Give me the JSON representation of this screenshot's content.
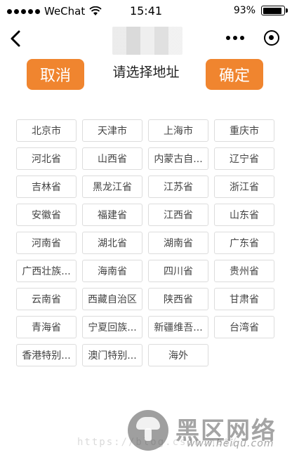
{
  "status_bar": {
    "carrier": "WeChat",
    "time": "15:41",
    "battery": "93%"
  },
  "navbar": {
    "back_icon": "chevron-left-icon",
    "more_icon": "more-dots-icon",
    "close_icon": "target-circle-icon"
  },
  "picker": {
    "cancel_label": "取消",
    "title": "请选择地址",
    "confirm_label": "确定",
    "accent_color": "#f0852f",
    "regions": [
      "北京市",
      "天津市",
      "上海市",
      "重庆市",
      "河北省",
      "山西省",
      "内蒙古自...",
      "辽宁省",
      "吉林省",
      "黑龙江省",
      "江苏省",
      "浙江省",
      "安徽省",
      "福建省",
      "江西省",
      "山东省",
      "河南省",
      "湖北省",
      "湖南省",
      "广东省",
      "广西壮族...",
      "海南省",
      "四川省",
      "贵州省",
      "云南省",
      "西藏自治区",
      "陕西省",
      "甘肃省",
      "青海省",
      "宁夏回族...",
      "新疆维吾...",
      "台湾省",
      "香港特别...",
      "澳门特别...",
      "海外"
    ]
  },
  "watermark": {
    "url": "https://blog.csdn.net/",
    "name": "黑区网络",
    "domain": "www.heiqu.com"
  }
}
